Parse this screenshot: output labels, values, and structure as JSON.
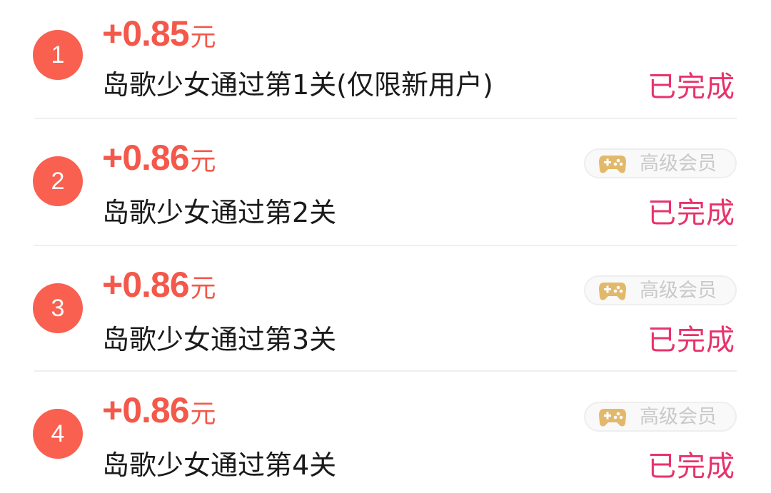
{
  "tasks": [
    {
      "number": "1",
      "reward_amount": "+0.85",
      "reward_unit": "元",
      "title": "岛歌少女通过第1关(仅限新用户)",
      "status": "已完成",
      "member_tag": ""
    },
    {
      "number": "2",
      "reward_amount": "+0.86",
      "reward_unit": "元",
      "title": "岛歌少女通过第2关",
      "status": "已完成",
      "member_tag": "高级会员"
    },
    {
      "number": "3",
      "reward_amount": "+0.86",
      "reward_unit": "元",
      "title": "岛歌少女通过第3关",
      "status": "已完成",
      "member_tag": "高级会员"
    },
    {
      "number": "4",
      "reward_amount": "+0.86",
      "reward_unit": "元",
      "title": "岛歌少女通过第4关",
      "status": "已完成",
      "member_tag": "高级会员"
    }
  ],
  "colors": {
    "badge": "#f96050",
    "reward": "#f4584a",
    "status": "#e8336c",
    "member_icon": "#e2b96a",
    "member_text": "#c9c9c9"
  },
  "icons": {
    "member": "gamepad-icon"
  }
}
